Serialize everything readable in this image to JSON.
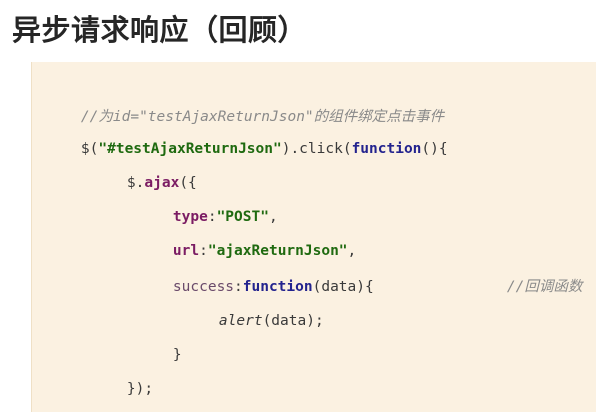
{
  "slide": {
    "title": "异步请求响应（回顾）"
  },
  "code": {
    "line1": {
      "comment": "//为id=\"testAjaxReturnJson\"的组件绑定点击事件"
    },
    "line2": {
      "dollar": "$(",
      "selector": "\"#testAjaxReturnJson\"",
      "dot_click": ").click(",
      "function_kw": "function",
      "tail": "(){"
    },
    "line3": {
      "dollar": "$.",
      "ajax": "ajax",
      "tail": "({"
    },
    "line4": {
      "key": "type",
      "colon": ":",
      "value": "\"POST\"",
      "comma": ","
    },
    "line5": {
      "key": "url",
      "colon": ":",
      "value": "\"ajaxReturnJson\"",
      "comma": ","
    },
    "line6": {
      "key": "success",
      "colon": ":",
      "function_kw": "function",
      "params": "(data){",
      "comment": "//回调函数"
    },
    "line7": {
      "call": "alert",
      "args": "(data);"
    },
    "line8": {
      "text": "}"
    },
    "line9": {
      "text": "});"
    },
    "line10": {
      "text": "});"
    }
  }
}
